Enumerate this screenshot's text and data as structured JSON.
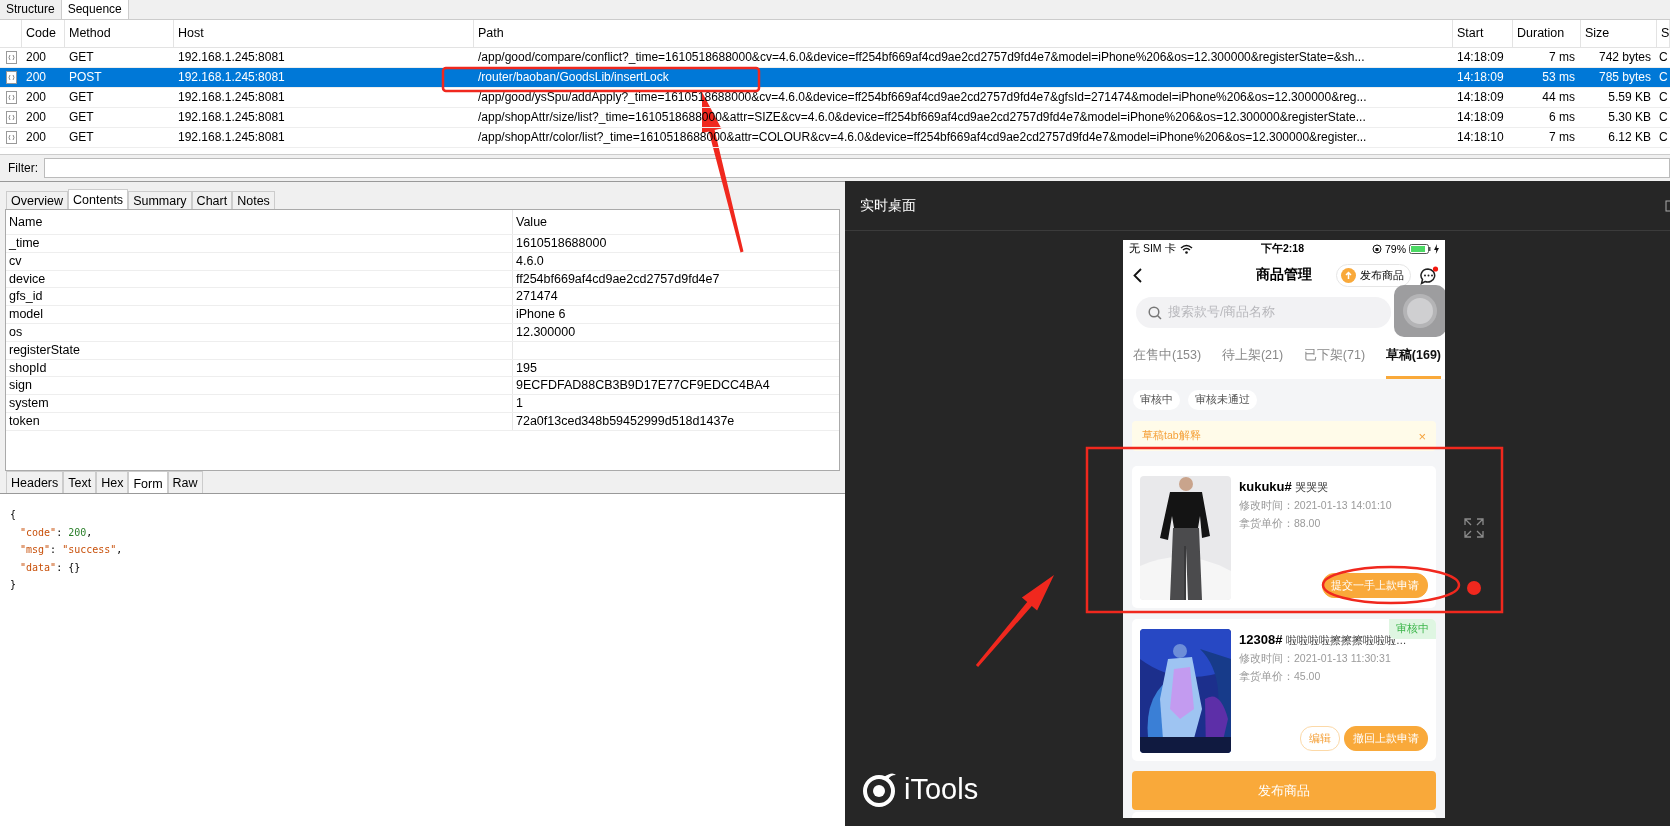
{
  "capture_tabs": [
    {
      "label": "Structure",
      "selected": false
    },
    {
      "label": "Sequence",
      "selected": true
    }
  ],
  "requests": {
    "columns": [
      "Code",
      "Method",
      "Host",
      "Path",
      "Start",
      "Duration",
      "Size",
      "S"
    ],
    "rows": [
      {
        "code": "200",
        "method": "GET",
        "host": "192.168.1.245:8081",
        "path": "/app/good/compare/conflict?_time=1610518688000&cv=4.6.0&device=ff254bf669af4cd9ae2cd2757d9fd4e7&model=iPhone%206&os=12.300000&registerState=&sh...",
        "start": "14:18:09",
        "duration": "7 ms",
        "size": "742 bytes",
        "column_9": "C",
        "selected": false
      },
      {
        "code": "200",
        "method": "POST",
        "host": "192.168.1.245:8081",
        "path": "/router/baoban/GoodsLib/insertLock",
        "start": "14:18:09",
        "duration": "53 ms",
        "size": "785 bytes",
        "column_9": "C",
        "selected": true
      },
      {
        "code": "200",
        "method": "GET",
        "host": "192.168.1.245:8081",
        "path": "/app/good/ysSpu/addApply?_time=1610518688000&cv=4.6.0&device=ff254bf669af4cd9ae2cd2757d9fd4e7&gfsId=271474&model=iPhone%206&os=12.300000&reg...",
        "start": "14:18:09",
        "duration": "44 ms",
        "size": "5.59 KB",
        "column_9": "C",
        "selected": false
      },
      {
        "code": "200",
        "method": "GET",
        "host": "192.168.1.245:8081",
        "path": "/app/shopAttr/size/list?_time=1610518688000&attr=SIZE&cv=4.6.0&device=ff254bf669af4cd9ae2cd2757d9fd4e7&model=iPhone%206&os=12.300000&registerState...",
        "start": "14:18:09",
        "duration": "6 ms",
        "size": "5.30 KB",
        "column_9": "C",
        "selected": false
      },
      {
        "code": "200",
        "method": "GET",
        "host": "192.168.1.245:8081",
        "path": "/app/shopAttr/color/list?_time=1610518688000&attr=COLOUR&cv=4.6.0&device=ff254bf669af4cd9ae2cd2757d9fd4e7&model=iPhone%206&os=12.300000&register...",
        "start": "14:18:10",
        "duration": "7 ms",
        "size": "6.12 KB",
        "column_9": "C",
        "selected": false
      }
    ]
  },
  "filter": {
    "label": "Filter:"
  },
  "detail_tabs": [
    {
      "label": "Overview",
      "selected": false
    },
    {
      "label": "Contents",
      "selected": true
    },
    {
      "label": "Summary",
      "selected": false
    },
    {
      "label": "Chart",
      "selected": false
    },
    {
      "label": "Notes",
      "selected": false
    }
  ],
  "form_table": {
    "columns": [
      "Name",
      "Value"
    ],
    "rows": [
      {
        "name": "_time",
        "value": "1610518688000"
      },
      {
        "name": "cv",
        "value": "4.6.0"
      },
      {
        "name": "device",
        "value": "ff254bf669af4cd9ae2cd2757d9fd4e7"
      },
      {
        "name": "gfs_id",
        "value": "271474"
      },
      {
        "name": "model",
        "value": "iPhone 6"
      },
      {
        "name": "os",
        "value": "12.300000"
      },
      {
        "name": "registerState"
      },
      {
        "name": "shopId",
        "value": "195"
      },
      {
        "name": "sign",
        "value": "9ECFDFAD88CB3B9D17E77CF9EDCC4BA4"
      },
      {
        "name": "system",
        "value": "1"
      },
      {
        "name": "token",
        "value": "72a0f13ced348b59452999d518d1437e"
      }
    ]
  },
  "body_tabs": [
    {
      "label": "Headers",
      "selected": false
    },
    {
      "label": "Text",
      "selected": false
    },
    {
      "label": "Hex",
      "selected": false
    },
    {
      "label": "Form",
      "selected": true
    },
    {
      "label": "Raw",
      "selected": false
    }
  ],
  "response_body": {
    "open": "{",
    "members": [
      [
        {
          "kind": "key",
          "text": "\"code\""
        },
        {
          "kind": "punct",
          "text": ": "
        },
        {
          "kind": "number",
          "text": "200"
        },
        {
          "kind": "punct",
          "text": ","
        }
      ],
      [
        {
          "kind": "key",
          "text": "\"msg\""
        },
        {
          "kind": "punct",
          "text": ": "
        },
        {
          "kind": "string",
          "text": "\"success\""
        },
        {
          "kind": "punct",
          "text": ","
        }
      ],
      [
        {
          "kind": "key",
          "text": "\"data\""
        },
        {
          "kind": "punct",
          "text": ": "
        },
        {
          "kind": "punct",
          "text": "{}"
        }
      ]
    ],
    "close": "}"
  },
  "mirror_window": {
    "title": "实时桌面",
    "logo_text": "iTools"
  },
  "phone": {
    "status_bar": {
      "carrier": "无 SIM 卡",
      "time": "下午2:18",
      "battery": "79%"
    },
    "nav": {
      "title": "商品管理",
      "publish_button": "发布商品"
    },
    "search": {
      "placeholder": "搜索款号/商品名称"
    },
    "tabs": [
      {
        "label": "在售中(153)",
        "selected": false
      },
      {
        "label": "待上架(21)",
        "selected": false
      },
      {
        "label": "已下架(71)",
        "selected": false
      },
      {
        "label": "草稿(169)",
        "selected": true
      }
    ],
    "filters": [
      {
        "label": "审核中"
      },
      {
        "label": "审核未通过"
      }
    ],
    "notice": {
      "text": "草稿tab解释",
      "close": "×"
    },
    "products": [
      {
        "code": "kukuku#",
        "name": "哭哭哭",
        "modified": "修改时间：2021-01-13 14:01:10",
        "price": "拿货单价：88.00",
        "actions": [
          {
            "label": "提交一手上款申请",
            "kind": "filled"
          }
        ]
      },
      {
        "code": "12308#",
        "name": "啦啦啦啦擦擦擦啦啦啦…",
        "badge": "审核中",
        "modified": "修改时间：2021-01-13 11:30:31",
        "price": "拿货单价：45.00",
        "actions": [
          {
            "label": "编辑",
            "kind": "outline"
          },
          {
            "label": "撤回上款申请",
            "kind": "filled"
          }
        ]
      }
    ],
    "publish_bar": "发布商品"
  }
}
